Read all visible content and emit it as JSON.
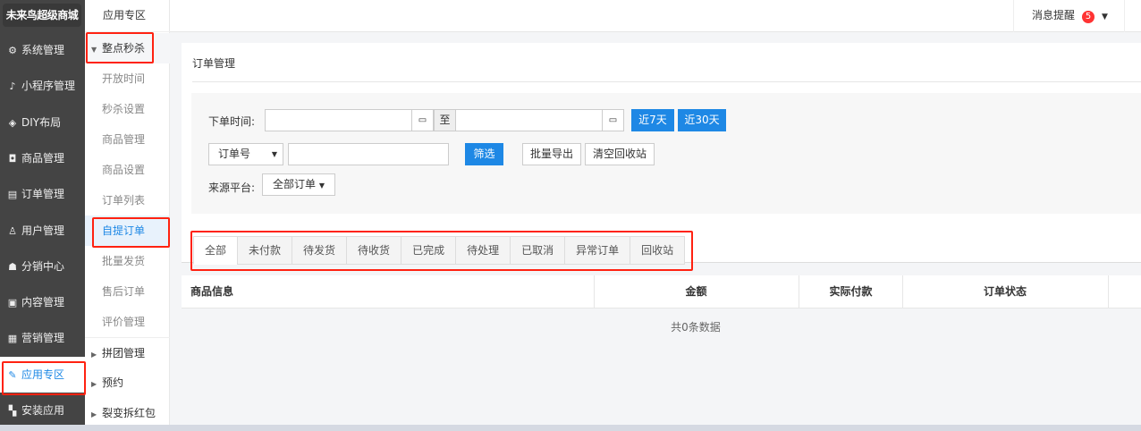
{
  "app": {
    "brand": "未来鸟超级商城"
  },
  "sidebar": {
    "items": [
      {
        "icon": "gear-icon",
        "glyph": "⚙",
        "label": "系统管理"
      },
      {
        "icon": "tiktok-icon",
        "glyph": "♪",
        "label": "小程序管理"
      },
      {
        "icon": "diamond-icon",
        "glyph": "◈",
        "label": "DIY布局"
      },
      {
        "icon": "bag-icon",
        "glyph": "◘",
        "label": "商品管理"
      },
      {
        "icon": "clipboard-icon",
        "glyph": "▤",
        "label": "订单管理"
      },
      {
        "icon": "user-icon",
        "glyph": "♙",
        "label": "用户管理"
      },
      {
        "icon": "network-icon",
        "glyph": "☗",
        "label": "分销中心"
      },
      {
        "icon": "content-icon",
        "glyph": "▣",
        "label": "内容管理"
      },
      {
        "icon": "ticket-icon",
        "glyph": "▦",
        "label": "营销管理"
      },
      {
        "icon": "puzzle-icon",
        "glyph": "✎",
        "label": "应用专区"
      },
      {
        "icon": "apps-icon",
        "glyph": "▚",
        "label": "安装应用"
      }
    ]
  },
  "subnav": {
    "title": "应用专区",
    "group": "整点秒杀",
    "items": [
      "开放时间",
      "秒杀设置",
      "商品管理",
      "商品设置",
      "订单列表",
      "自提订单",
      "批量发货",
      "售后订单",
      "评价管理"
    ],
    "collapsed": [
      "拼团管理",
      "预约",
      "裂变拆红包"
    ]
  },
  "topbar": {
    "message_label": "消息提醒",
    "message_count": "5"
  },
  "page": {
    "title": "订单管理"
  },
  "filter": {
    "order_time_label": "下单时间:",
    "to_label": "至",
    "last7": "近7天",
    "last30": "近30天",
    "search_type": "订单号",
    "search_value": "",
    "filter_btn": "筛选",
    "export_btn": "批量导出",
    "clear_btn": "清空回收站",
    "source_label": "来源平台:",
    "source_value": "全部订单"
  },
  "tabs": [
    "全部",
    "未付款",
    "待发货",
    "待收货",
    "已完成",
    "待处理",
    "已取消",
    "异常订单",
    "回收站"
  ],
  "table": {
    "columns": [
      "商品信息",
      "金额",
      "实际付款",
      "订单状态"
    ],
    "empty": "共0条数据"
  }
}
